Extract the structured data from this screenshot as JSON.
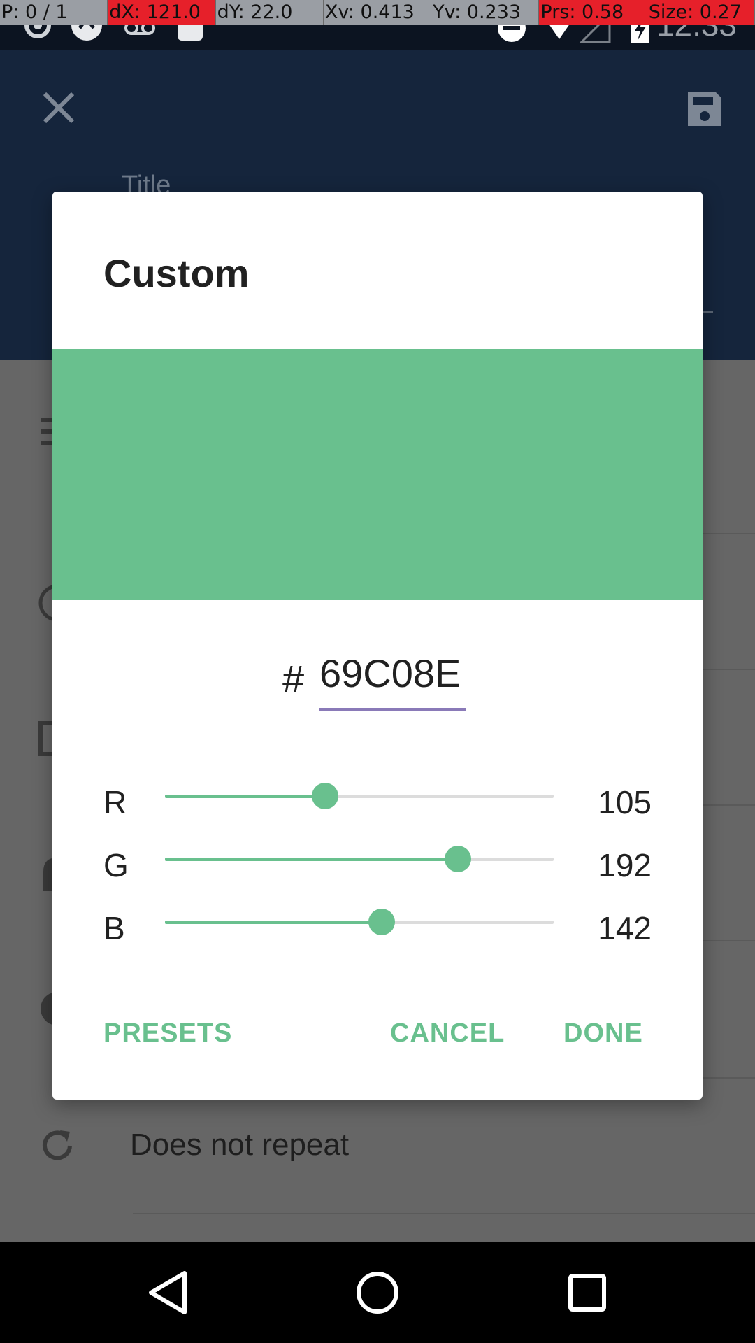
{
  "accent_color": "#69C08E",
  "status_bar": {
    "debug_overlay": [
      "P: 0 / 1",
      "dX: 121.0",
      "dY: 22.0",
      "Xv: 0.413",
      "Yv: 0.233",
      "Prs: 0.58",
      "Size: 0.27"
    ],
    "time": "12:33",
    "icons": [
      "settings-icon",
      "sync-icon",
      "voicemail-icon",
      "android-icon",
      "do-not-disturb-icon",
      "wifi-icon",
      "signal-icon",
      "battery-charging-icon"
    ]
  },
  "app_bar": {
    "close_icon": "close-icon",
    "save_icon": "save-icon",
    "title_hint": "Title"
  },
  "event": {
    "repeat": "Does not repeat"
  },
  "dialog": {
    "title": "Custom",
    "preview_color": "#69C08E",
    "hex_prefix": "#",
    "hex_value": "69C08E",
    "channels": [
      {
        "label": "R",
        "value": "105",
        "level": 0.412
      },
      {
        "label": "G",
        "value": "192",
        "level": 0.753
      },
      {
        "label": "B",
        "value": "142",
        "level": 0.557
      }
    ],
    "actions": {
      "presets": "PRESETS",
      "cancel": "CANCEL",
      "done": "DONE"
    }
  },
  "nav_bar": {
    "back_icon": "back-icon",
    "home_icon": "home-icon",
    "recents_icon": "recents-icon"
  }
}
